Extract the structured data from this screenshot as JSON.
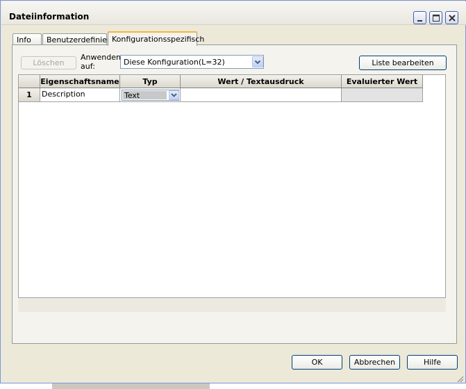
{
  "window": {
    "title": "Dateiinformation"
  },
  "tabs": [
    {
      "label": "Info"
    },
    {
      "label": "Benutzerdefiniert"
    },
    {
      "label": "Konfigurationsspezifisch"
    }
  ],
  "toolbar": {
    "delete_label": "Löschen",
    "apply_label_line1": "Anwenden",
    "apply_label_line2": "auf:",
    "config_selected": "Diese Konfiguration(L=32)",
    "edit_list_label": "Liste bearbeiten"
  },
  "grid": {
    "columns": [
      "Eigenschaftsname",
      "Typ",
      "Wert / Textausdruck",
      "Evaluierter Wert"
    ],
    "rows": [
      {
        "number": "1",
        "name": "Description",
        "type": "Text",
        "value": "",
        "evaluated": ""
      }
    ]
  },
  "footer": {
    "ok_label": "OK",
    "cancel_label": "Abbrechen",
    "help_label": "Hilfe"
  }
}
